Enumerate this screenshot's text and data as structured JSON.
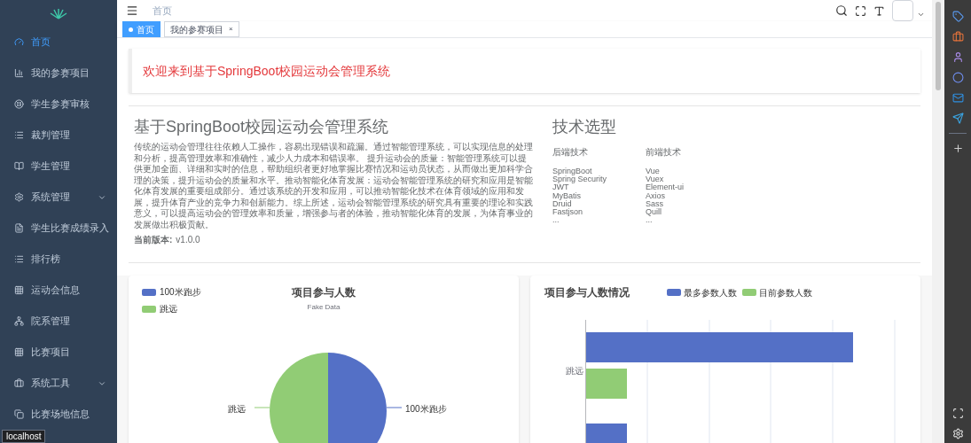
{
  "sidebar": {
    "items": [
      {
        "label": "首页",
        "kind": "link",
        "selected": true
      },
      {
        "label": "我的参赛项目",
        "kind": "link",
        "selected": false
      },
      {
        "label": "学生参赛审核",
        "kind": "link",
        "selected": false
      },
      {
        "label": "裁判管理",
        "kind": "link",
        "selected": false
      },
      {
        "label": "学生管理",
        "kind": "link",
        "selected": false
      },
      {
        "label": "系统管理",
        "kind": "submenu",
        "selected": false
      },
      {
        "label": "学生比赛成绩录入",
        "kind": "link",
        "selected": false
      },
      {
        "label": "排行榜",
        "kind": "link",
        "selected": false
      },
      {
        "label": "运动会信息",
        "kind": "link",
        "selected": false
      },
      {
        "label": "院系管理",
        "kind": "link",
        "selected": false
      },
      {
        "label": "比赛项目",
        "kind": "link",
        "selected": false
      },
      {
        "label": "系统工具",
        "kind": "submenu",
        "selected": false
      },
      {
        "label": "比赛场地信息",
        "kind": "link",
        "selected": false
      }
    ]
  },
  "tooltip": "localhost",
  "header": {
    "breadcrumb": "首页"
  },
  "tags": [
    {
      "label": "首页",
      "selected": true
    },
    {
      "label": "我的参赛项目",
      "selected": false,
      "close": "×"
    }
  ],
  "welcome": "欢迎来到基于SpringBoot校园运动会管理系统",
  "intro": {
    "title": "基于SpringBoot校园运动会管理系统",
    "text": "传统的运动会管理往往依赖人工操作，容易出现错误和疏漏。通过智能管理系统，可以实现信息的处理和分析，提高管理效率和准确性，减少人力成本和错误率。 提升运动会的质量：智能管理系统可以提供更加全面、详细和实时的信息，帮助组织者更好地掌握比赛情况和运动员状态，从而做出更加科学合理的决策，提升运动会的质量和水平。推动智能化体育发展：运动会智能管理系统的研究和应用是智能化体育发展的重要组成部分。通过该系统的开发和应用，可以推动智能化技术在体育领域的应用和发展，提升体育产业的竞争力和创新能力。综上所述，运动会智能管理系统的研究具有重要的理论和实践意义，可以提高运动会的管理效率和质量，增强参与者的体验，推动智能化体育的发展，为体育事业的发展做出积极贡献。",
    "version_label": "当前版本:",
    "version": "v1.0.0"
  },
  "tech": {
    "title": "技术选型",
    "columns": [
      {
        "heading": "后端技术",
        "items": [
          "SpringBoot",
          "Spring Security",
          "JWT",
          "MyBatis",
          "Druid",
          "Fastjson",
          "..."
        ]
      },
      {
        "heading": "前端技术",
        "items": [
          "Vue",
          "Vuex",
          "Element-ui",
          "Axios",
          "Sass",
          "Quill",
          "..."
        ]
      }
    ]
  },
  "pie_card": {
    "title": "项目参与人数",
    "subtitle": "Fake Data",
    "legend": [
      {
        "label": "100米跑步",
        "color": "#5470c6"
      },
      {
        "label": "跳远",
        "color": "#91cc75"
      }
    ],
    "slice_labels": [
      "跳远",
      "100米跑步"
    ]
  },
  "bar_card": {
    "title": "项目参与人数情况",
    "legend": [
      {
        "label": "最多参数人数",
        "color": "#5470c6"
      },
      {
        "label": "目前参数人数",
        "color": "#91cc75"
      }
    ],
    "category": "跳远"
  }
}
